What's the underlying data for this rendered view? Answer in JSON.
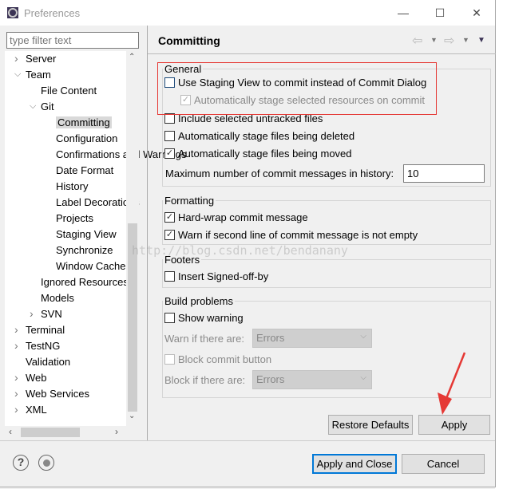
{
  "window": {
    "title": "Preferences",
    "minimize": "—",
    "maximize": "☐",
    "close": "✕"
  },
  "filter": {
    "placeholder": "type filter text"
  },
  "tree": [
    {
      "label": "Server",
      "level": 0,
      "chev": "right"
    },
    {
      "label": "Team",
      "level": 0,
      "chev": "down"
    },
    {
      "label": "File Content",
      "level": 1,
      "chev": ""
    },
    {
      "label": "Git",
      "level": 1,
      "chev": "down"
    },
    {
      "label": "Committing",
      "level": 2,
      "chev": "",
      "selected": true
    },
    {
      "label": "Configuration",
      "level": 2,
      "chev": ""
    },
    {
      "label": "Confirmations and Warnings",
      "level": 2,
      "chev": ""
    },
    {
      "label": "Date Format",
      "level": 2,
      "chev": ""
    },
    {
      "label": "History",
      "level": 2,
      "chev": ""
    },
    {
      "label": "Label Decorations",
      "level": 2,
      "chev": ""
    },
    {
      "label": "Projects",
      "level": 2,
      "chev": ""
    },
    {
      "label": "Staging View",
      "level": 2,
      "chev": ""
    },
    {
      "label": "Synchronize",
      "level": 2,
      "chev": ""
    },
    {
      "label": "Window Cache",
      "level": 2,
      "chev": ""
    },
    {
      "label": "Ignored Resources",
      "level": 1,
      "chev": ""
    },
    {
      "label": "Models",
      "level": 1,
      "chev": ""
    },
    {
      "label": "SVN",
      "level": 1,
      "chev": "right"
    },
    {
      "label": "Terminal",
      "level": 0,
      "chev": "right"
    },
    {
      "label": "TestNG",
      "level": 0,
      "chev": "right"
    },
    {
      "label": "Validation",
      "level": 0,
      "chev": ""
    },
    {
      "label": "Web",
      "level": 0,
      "chev": "right"
    },
    {
      "label": "Web Services",
      "level": 0,
      "chev": "right"
    },
    {
      "label": "XML",
      "level": 0,
      "chev": "right"
    }
  ],
  "page": {
    "title": "Committing",
    "general": {
      "label": "General",
      "use_staging": {
        "label": "Use Staging View to commit instead of Commit Dialog",
        "checked": false
      },
      "auto_stage_selected": {
        "label": "Automatically stage selected resources on commit",
        "checked": true,
        "disabled": true
      },
      "include_untracked": {
        "label": "Include selected untracked files",
        "checked": false
      },
      "stage_deleted": {
        "label": "Automatically stage files being deleted",
        "checked": false
      },
      "stage_moved": {
        "label": "Automatically stage files being moved",
        "checked": true
      },
      "max_messages_label": "Maximum number of commit messages in history:",
      "max_messages_value": "10"
    },
    "formatting": {
      "label": "Formatting",
      "hard_wrap": {
        "label": "Hard-wrap commit message",
        "checked": true
      },
      "warn_second_line": {
        "label": "Warn if second line of commit message is not empty",
        "checked": true
      }
    },
    "footers": {
      "label": "Footers",
      "signed_off": {
        "label": "Insert Signed-off-by",
        "checked": false
      }
    },
    "build": {
      "label": "Build problems",
      "show_warning": {
        "label": "Show warning",
        "checked": false
      },
      "warn_label": "Warn if there are:",
      "warn_value": "Errors",
      "block_commit": {
        "label": "Block commit button",
        "checked": false
      },
      "block_label": "Block if there are:",
      "block_value": "Errors"
    },
    "restore_defaults": "Restore Defaults",
    "apply": "Apply"
  },
  "footer": {
    "apply_close": "Apply and Close",
    "cancel": "Cancel",
    "help_icon": "?"
  },
  "watermark": "http://blog.csdn.net/bendanany",
  "colors": {
    "annotation": "#e53935",
    "focus": "#0078d7"
  }
}
